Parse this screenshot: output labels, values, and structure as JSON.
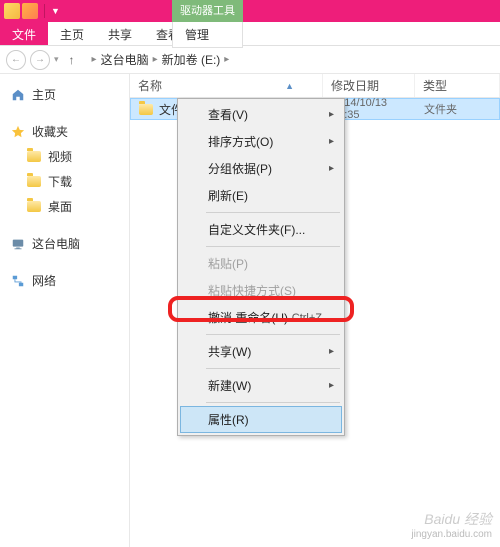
{
  "ribbon": {
    "file": "文件",
    "home": "主页",
    "share": "共享",
    "view": "查看",
    "tool_label": "驱动器工具",
    "tool_tab": "管理"
  },
  "breadcrumb": {
    "pc": "这台电脑",
    "vol": "新加卷 (E:)"
  },
  "sidebar": {
    "home": "主页",
    "fav": "收藏夹",
    "video": "视频",
    "download": "下载",
    "desktop": "桌面",
    "pc": "这台电脑",
    "network": "网络"
  },
  "columns": {
    "name": "名称",
    "date": "修改日期",
    "type": "类型"
  },
  "file": {
    "name": "文件",
    "date": "2014/10/13 13:35",
    "type": "文件夹"
  },
  "menu": {
    "view": "查看(V)",
    "sort": "排序方式(O)",
    "group": "分组依据(P)",
    "refresh": "刷新(E)",
    "custom": "自定义文件夹(F)...",
    "paste": "粘贴(P)",
    "paste_shortcut": "粘贴快捷方式(S)",
    "undo": "撤消 重命名(U)",
    "undo_key": "Ctrl+Z",
    "share": "共享(W)",
    "new": "新建(W)",
    "props": "属性(R)"
  },
  "watermark": {
    "brand": "Baidu 经验",
    "url": "jingyan.baidu.com"
  }
}
